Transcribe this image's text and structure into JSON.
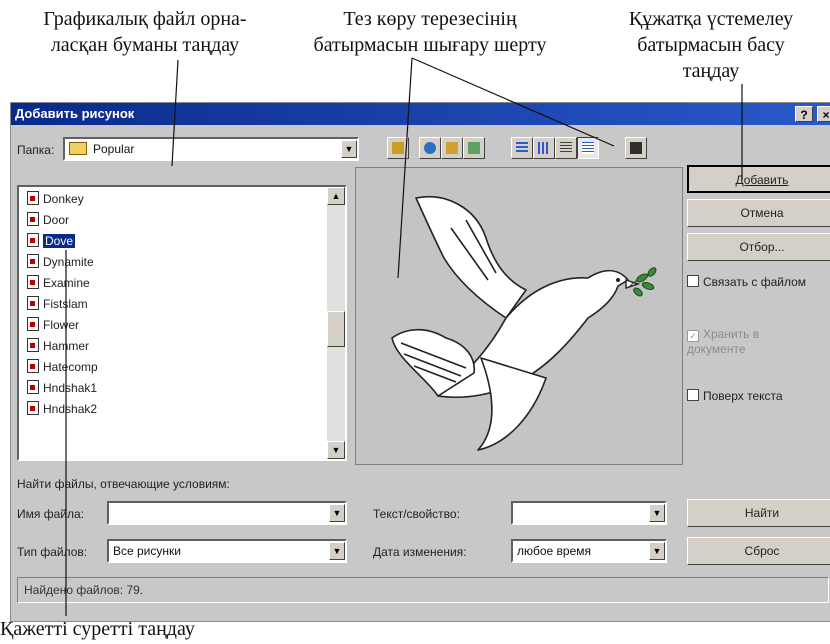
{
  "annotations": {
    "folder_select": "Графикалық файл орна-\nласқан буманы таңдау",
    "preview_button": "Тез көру терезесінің\nбатырмасын шығару  шерту",
    "add_button": "Құжатқа үстемелеу\nбатырмасын басу\nтаңдау",
    "pick_image": "Қажетті суретті таңдау"
  },
  "dialog": {
    "title": "Добавить рисунок",
    "help_button": "?",
    "close_button": "×",
    "folder_label": "Папка:",
    "folder_value": "Popular",
    "files": [
      "Donkey",
      "Door",
      "Dove",
      "Dynamite",
      "Examine",
      "Fistslam",
      "Flower",
      "Hammer",
      "Hatecomp",
      "Hndshak1",
      "Hndshak2"
    ],
    "selected_file": "Dove",
    "buttons": {
      "add": "Добавить",
      "cancel": "Отмена",
      "filter": "Отбор...",
      "find": "Найти",
      "reset": "Сброс"
    },
    "checkboxes": {
      "link": "Связать с файлом",
      "store": "Хранить в\nдокументе",
      "over_text": "Поверх текста"
    },
    "search_heading": "Найти файлы, отвечающие условиям:",
    "filename_label": "Имя файла:",
    "filename_value": "",
    "filetype_label": "Тип файлов:",
    "filetype_value": "Все рисунки",
    "text_label": "Текст/свойство:",
    "text_value": "",
    "date_label": "Дата изменения:",
    "date_value": "любое время",
    "status": "Найдено файлов: 79."
  }
}
